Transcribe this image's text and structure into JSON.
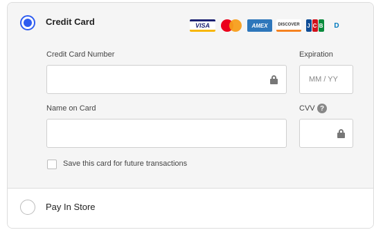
{
  "credit_card": {
    "title": "Credit Card",
    "selected": true,
    "brand_logos": [
      {
        "name": "visa-logo",
        "text": "VISA"
      },
      {
        "name": "mastercard-logo",
        "text": ""
      },
      {
        "name": "amex-logo",
        "text": "AMEX"
      },
      {
        "name": "discover-logo",
        "text": "DISCOVER"
      },
      {
        "name": "jcb-logo",
        "text": "JCB"
      },
      {
        "name": "diners-logo",
        "text": "D"
      }
    ],
    "card_number": {
      "label": "Credit Card Number",
      "value": ""
    },
    "expiration": {
      "label": "Expiration",
      "placeholder": "MM / YY",
      "value": ""
    },
    "name_on_card": {
      "label": "Name on Card",
      "value": ""
    },
    "cvv": {
      "label": "CVV",
      "value": ""
    },
    "help_glyph": "?",
    "save_card": {
      "label": "Save this card for future transactions",
      "checked": false
    }
  },
  "pay_in_store": {
    "label": "Pay In Store",
    "selected": false
  },
  "colors": {
    "accent": "#2e5cf0",
    "section_bg": "#f5f5f5",
    "border": "#dcdcdc"
  }
}
